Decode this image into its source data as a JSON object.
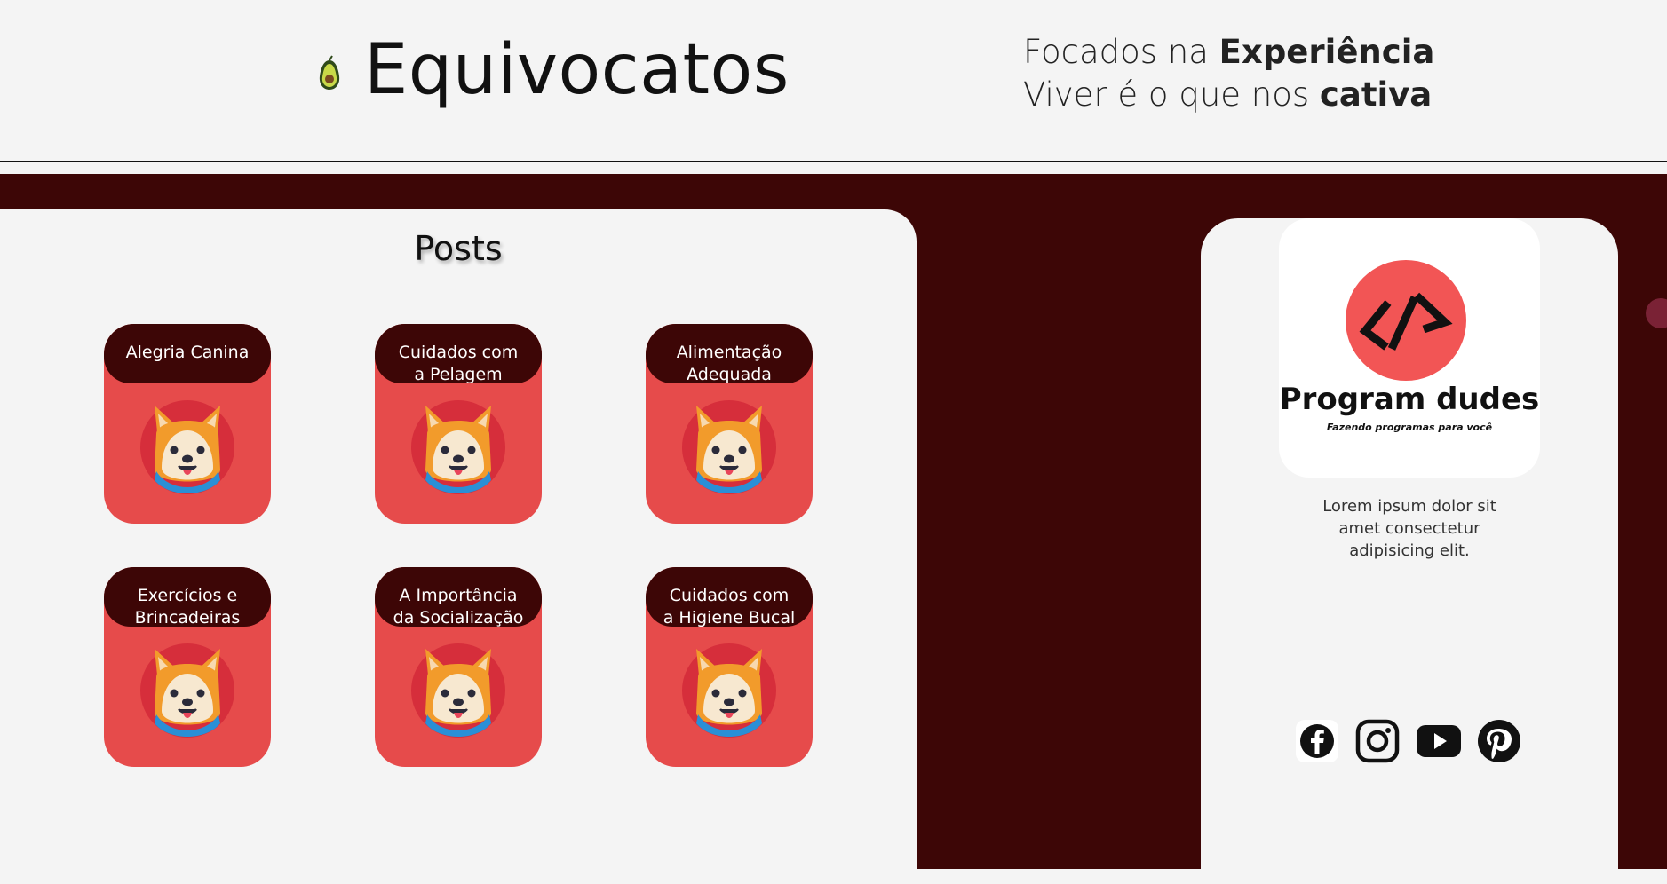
{
  "header": {
    "title": "Equivocatos",
    "tagline_line1_pre": "Focados na ",
    "tagline_line1_bold": "Experiência",
    "tagline_line2_pre": "Viver é o que nos ",
    "tagline_line2_bold": "cativa",
    "logo_icon": "avocado-icon"
  },
  "posts": {
    "title": "Posts",
    "items": [
      {
        "label": "Alegria Canina"
      },
      {
        "label": "Cuidados com a Pelagem"
      },
      {
        "label": "Alimentação Adequada"
      },
      {
        "label": "Exercícios e Brincadeiras"
      },
      {
        "label": "A Importância da Socialização"
      },
      {
        "label": "Cuidados com a Higiene Bucal"
      }
    ]
  },
  "sidebar": {
    "brand_name": "Program dudes",
    "brand_slogan": "Fazendo programas para você",
    "description": "Lorem ipsum dolor sit amet consectetur adipisicing elit.",
    "socials": [
      "facebook-icon",
      "instagram-icon",
      "youtube-icon",
      "pinterest-icon"
    ]
  },
  "colors": {
    "dark_red": "#3d0606",
    "card_red": "#e64b4b",
    "panel_bg": "#f4f4f4"
  }
}
